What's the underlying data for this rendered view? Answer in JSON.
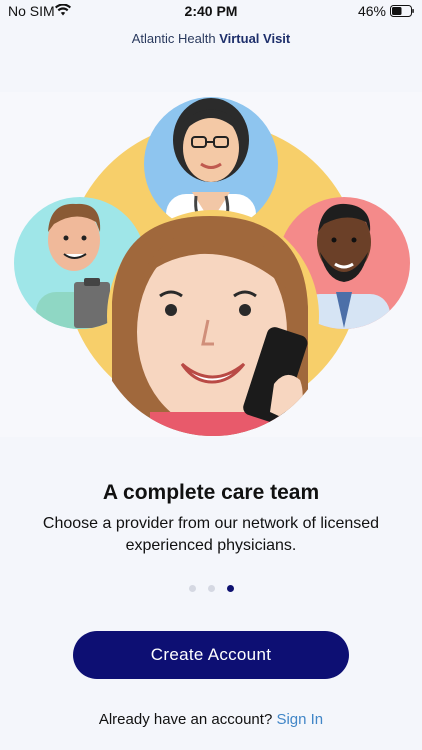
{
  "status_bar": {
    "carrier": "No SIM",
    "time": "2:40 PM",
    "battery": "46%",
    "wifi_icon": "wifi-icon",
    "battery_icon": "battery-icon"
  },
  "header": {
    "brand_normal": "Atlantic Health",
    "brand_bold": "Virtual Visit"
  },
  "slide": {
    "title": "A complete care team",
    "text": "Choose a provider from our network of licensed experienced physicians.",
    "page_count": 3,
    "active_page": 3
  },
  "actions": {
    "create_account": "Create Account",
    "signin_prompt": "Already have an account?",
    "signin_link": "Sign In"
  },
  "colors": {
    "primary": "#0d0f73",
    "link": "#4186c7",
    "background": "#f4f6fb"
  }
}
